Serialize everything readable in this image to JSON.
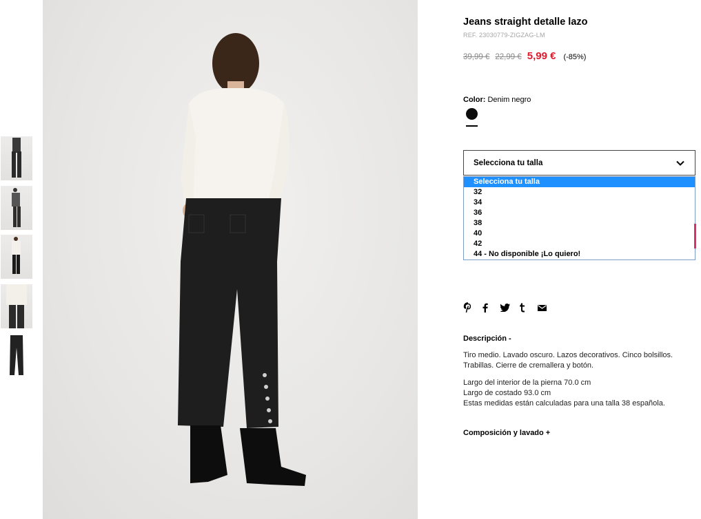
{
  "product": {
    "title": "Jeans straight detalle lazo",
    "ref": "REF. 23030779-ZIGZAG-LM",
    "price_original": "39,99 €",
    "price_previous": "22,99 €",
    "price_sale": "5,99 €",
    "discount": "(-85%)",
    "sale_color": "#e0192c"
  },
  "color": {
    "label": "Color:",
    "value": "Denim negro",
    "swatch_hex": "#0c0c0c"
  },
  "size": {
    "placeholder": "Selecciona tu talla",
    "options": [
      "Selecciona tu talla",
      "32",
      "34",
      "36",
      "38",
      "40",
      "42",
      "44 - No disponible ¡Lo quiero!"
    ],
    "highlight_hex": "#1e90ff"
  },
  "share_icons": [
    "pinterest-icon",
    "facebook-icon",
    "twitter-icon",
    "tumblr-icon",
    "email-icon"
  ],
  "description": {
    "heading": "Descripción -",
    "paragraph1": "Tiro medio. Lavado oscuro. Lazos decorativos. Cinco bolsillos. Trabillas. Cierre de cremallera y botón.",
    "line1": "Largo del interior de la pierna 70.0 cm",
    "line2": "Largo de costado 93.0 cm",
    "line3": "Estas medidas están calculadas para una talla 38 española."
  },
  "composition": {
    "heading": "Composición y lavado +"
  }
}
